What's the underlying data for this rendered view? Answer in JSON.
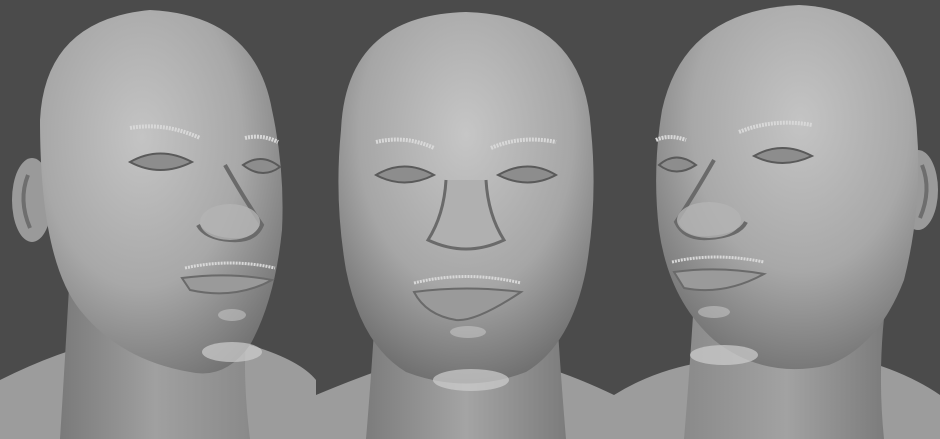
{
  "scene": {
    "background_color": "#4b4b4b",
    "model_color": "#a9a9a9",
    "shadow_color": "#5a5a5a",
    "hair_color": "#d8d8d8",
    "views": [
      {
        "id": "three-quarter-left"
      },
      {
        "id": "front"
      },
      {
        "id": "three-quarter-right"
      }
    ]
  }
}
